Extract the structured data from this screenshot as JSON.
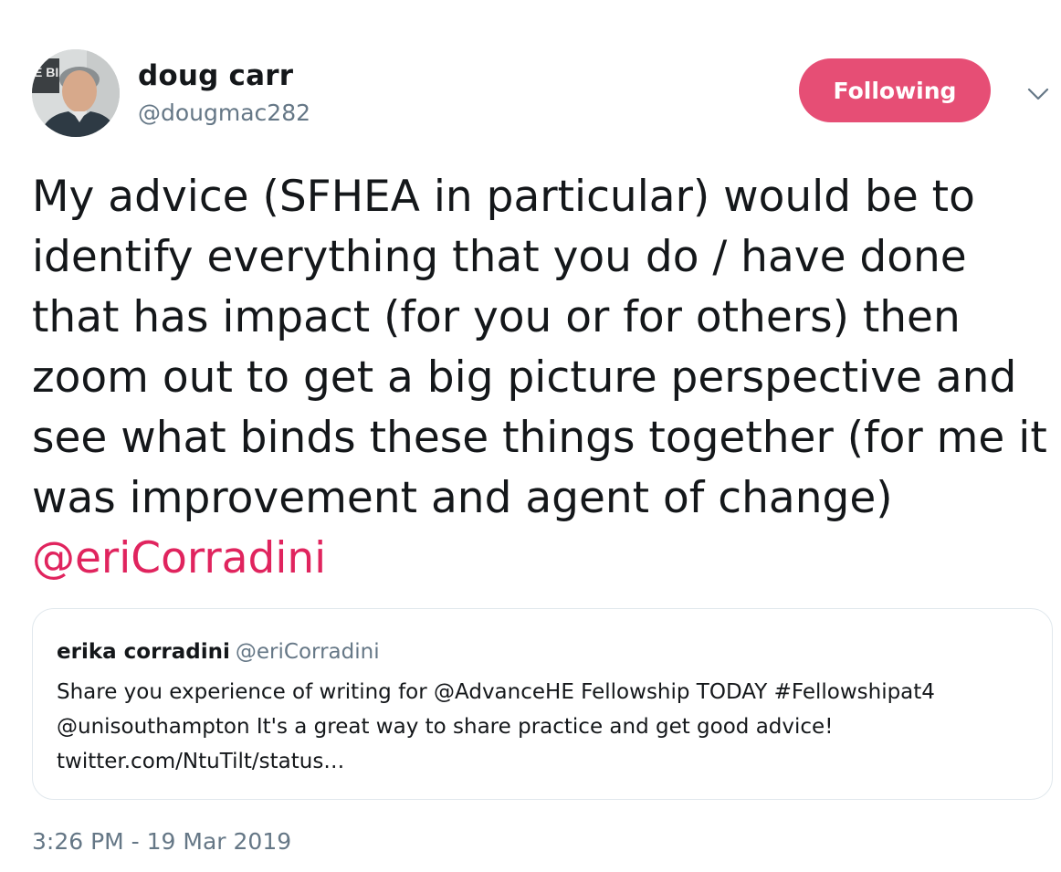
{
  "author": {
    "display_name": "doug carr",
    "handle": "@dougmac282",
    "avatar_sign_text": "E BI"
  },
  "follow_button": {
    "label": "Following",
    "color": "#e64e75"
  },
  "menu": {
    "icon": "chevron-down-icon"
  },
  "tweet": {
    "text": "My advice (SFHEA in particular) would be to identify everything that you do / have done that has impact (for you or for others) then zoom out to get a big picture perspective and see what binds these things together (for me it was improvement and agent of change)",
    "mention": "@eriCorradini",
    "mention_color": "#e0245e"
  },
  "quoted_tweet": {
    "name": "erika corradini",
    "handle": "@eriCorradini",
    "lines": [
      "Share you experience of writing for @AdvanceHE Fellowship TODAY #Fellowshipat4",
      "@unisouthampton It's a great way to share practice and get good advice!",
      "twitter.com/NtuTilt/status…"
    ]
  },
  "timestamp": "3:26 PM - 19 Mar 2019"
}
